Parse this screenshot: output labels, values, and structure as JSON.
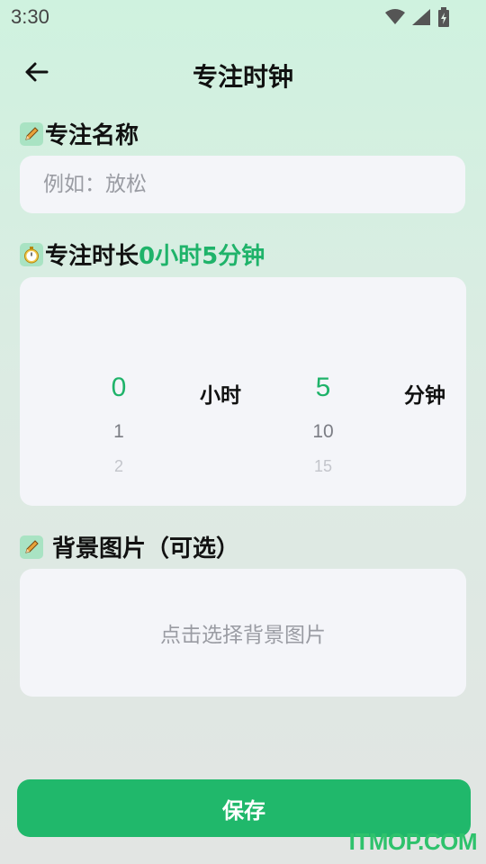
{
  "status_bar": {
    "time": "3:30"
  },
  "header": {
    "title": "专注时钟"
  },
  "focus_name": {
    "label": "专注名称",
    "placeholder": "例如：放松",
    "value": ""
  },
  "duration": {
    "label": "专注时长",
    "value_text": "0小时5分钟",
    "hours": {
      "selected": "0",
      "next": [
        "1",
        "2"
      ],
      "unit": "小时"
    },
    "minutes": {
      "selected": "5",
      "next": [
        "10",
        "15"
      ],
      "unit": "分钟"
    }
  },
  "background": {
    "label": "背景图片（可选）",
    "hint": "点击选择背景图片"
  },
  "save_label": "保存",
  "watermark": "ITMOP.COM",
  "colors": {
    "accent": "#1fb36a",
    "button": "#20b86b",
    "card": "#f4f5f9",
    "icon_bg": "#a9e3c3"
  }
}
